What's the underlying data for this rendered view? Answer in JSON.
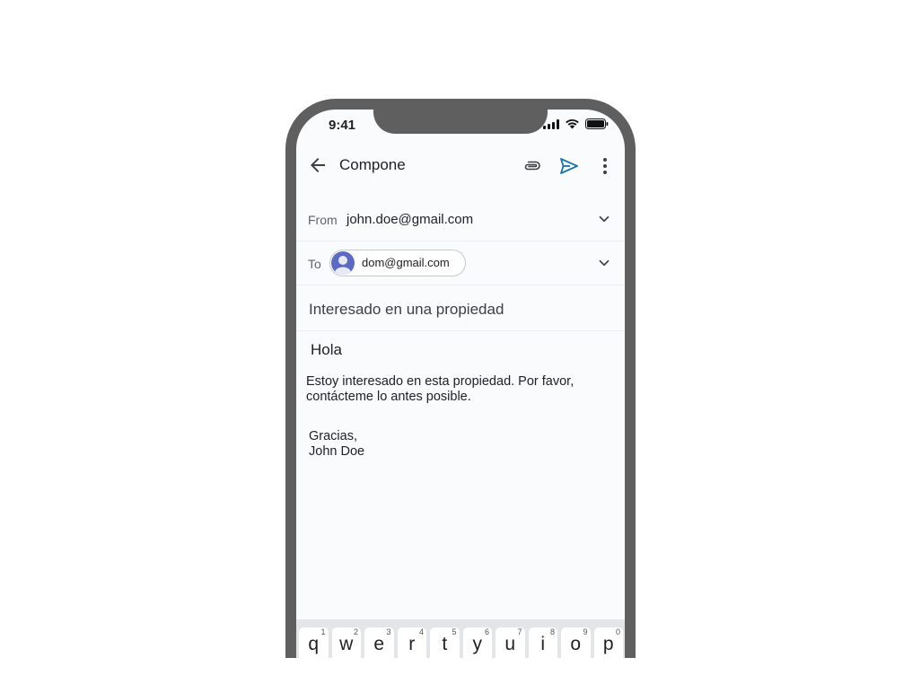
{
  "status_bar": {
    "time": "9:41"
  },
  "appbar": {
    "title": "Compone",
    "icons": [
      "arrow-back-icon",
      "paperclip-icon",
      "send-icon",
      "more-vert-icon"
    ],
    "send_color": "#1a73a0"
  },
  "from": {
    "label": "From",
    "value": "john.doe@gmail.com"
  },
  "to": {
    "label": "To",
    "chips": [
      {
        "email": "dom@gmail.com"
      }
    ]
  },
  "subject": "Interesado en una propiedad",
  "body": {
    "greeting": "Hola",
    "text": "Estoy interesado en esta propiedad. Por favor, contácteme lo antes posible.",
    "closing": "Gracias,",
    "signature": "John Doe"
  },
  "keyboard": {
    "keys": [
      {
        "char": "q",
        "num": "1"
      },
      {
        "char": "w",
        "num": "2"
      },
      {
        "char": "e",
        "num": "3"
      },
      {
        "char": "r",
        "num": "4"
      },
      {
        "char": "t",
        "num": "5"
      },
      {
        "char": "y",
        "num": "6"
      },
      {
        "char": "u",
        "num": "7"
      },
      {
        "char": "i",
        "num": "8"
      },
      {
        "char": "o",
        "num": "9"
      },
      {
        "char": "p",
        "num": "0"
      }
    ]
  }
}
